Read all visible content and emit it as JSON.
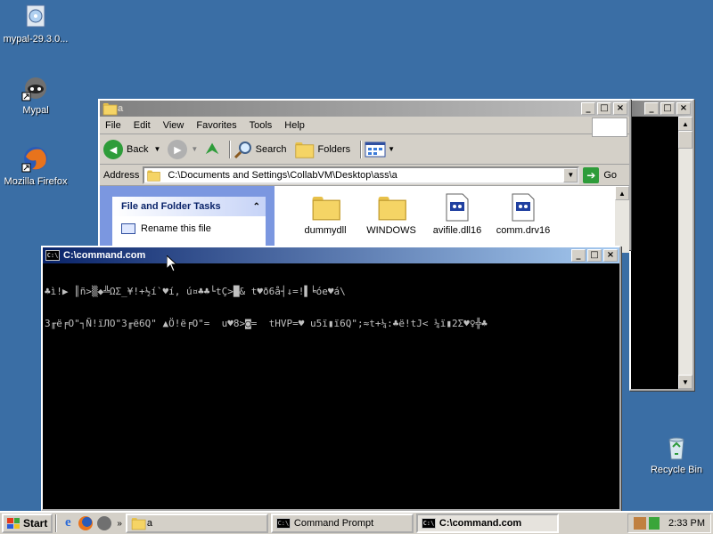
{
  "desktop": {
    "icons": [
      {
        "label": "mypal-29.3.0..."
      },
      {
        "label": "Mypal"
      },
      {
        "label": "Mozilla Firefox"
      },
      {
        "label": "Recycle Bin"
      }
    ]
  },
  "explorer": {
    "title": "a",
    "menu": [
      "File",
      "Edit",
      "View",
      "Favorites",
      "Tools",
      "Help"
    ],
    "toolbar": {
      "back": "Back",
      "search": "Search",
      "folders": "Folders"
    },
    "address_label": "Address",
    "address_value": "C:\\Documents and Settings\\CollabVM\\Desktop\\ass\\a",
    "go_label": "Go",
    "tasks_title": "File and Folder Tasks",
    "tasks": [
      "Rename this file"
    ],
    "files": [
      {
        "name": "dummydll",
        "icon": "folder"
      },
      {
        "name": "WINDOWS",
        "icon": "folder"
      },
      {
        "name": "avifile.dll16",
        "icon": "file"
      },
      {
        "name": "comm.drv16",
        "icon": "file"
      }
    ]
  },
  "console": {
    "title": "C:\\command.com",
    "lines": [
      "♣ì!▶ ║ñ>▒◆╩ΩΣ_¥!+½í`♥í, ú¤♣♣└tÇ>█& t♥ð6å┤↓=!▌╘óe♥á\\",
      "3╓ë╒O\"┐Ñ!ïЛO\"3╓ë6Q\" ▲Ö!ë╒O\"=  u♥8>◙=  tHVP=♥ u5ï▮ï6Q\";≈t+¼:♣ë!tJ< ¼ï▮2Σ♥♀╬♣"
    ]
  },
  "taskbar": {
    "start": "Start",
    "tasks": [
      {
        "label": "a"
      },
      {
        "label": "Command Prompt"
      },
      {
        "label": "C:\\command.com"
      }
    ],
    "clock": "2:33 PM"
  }
}
